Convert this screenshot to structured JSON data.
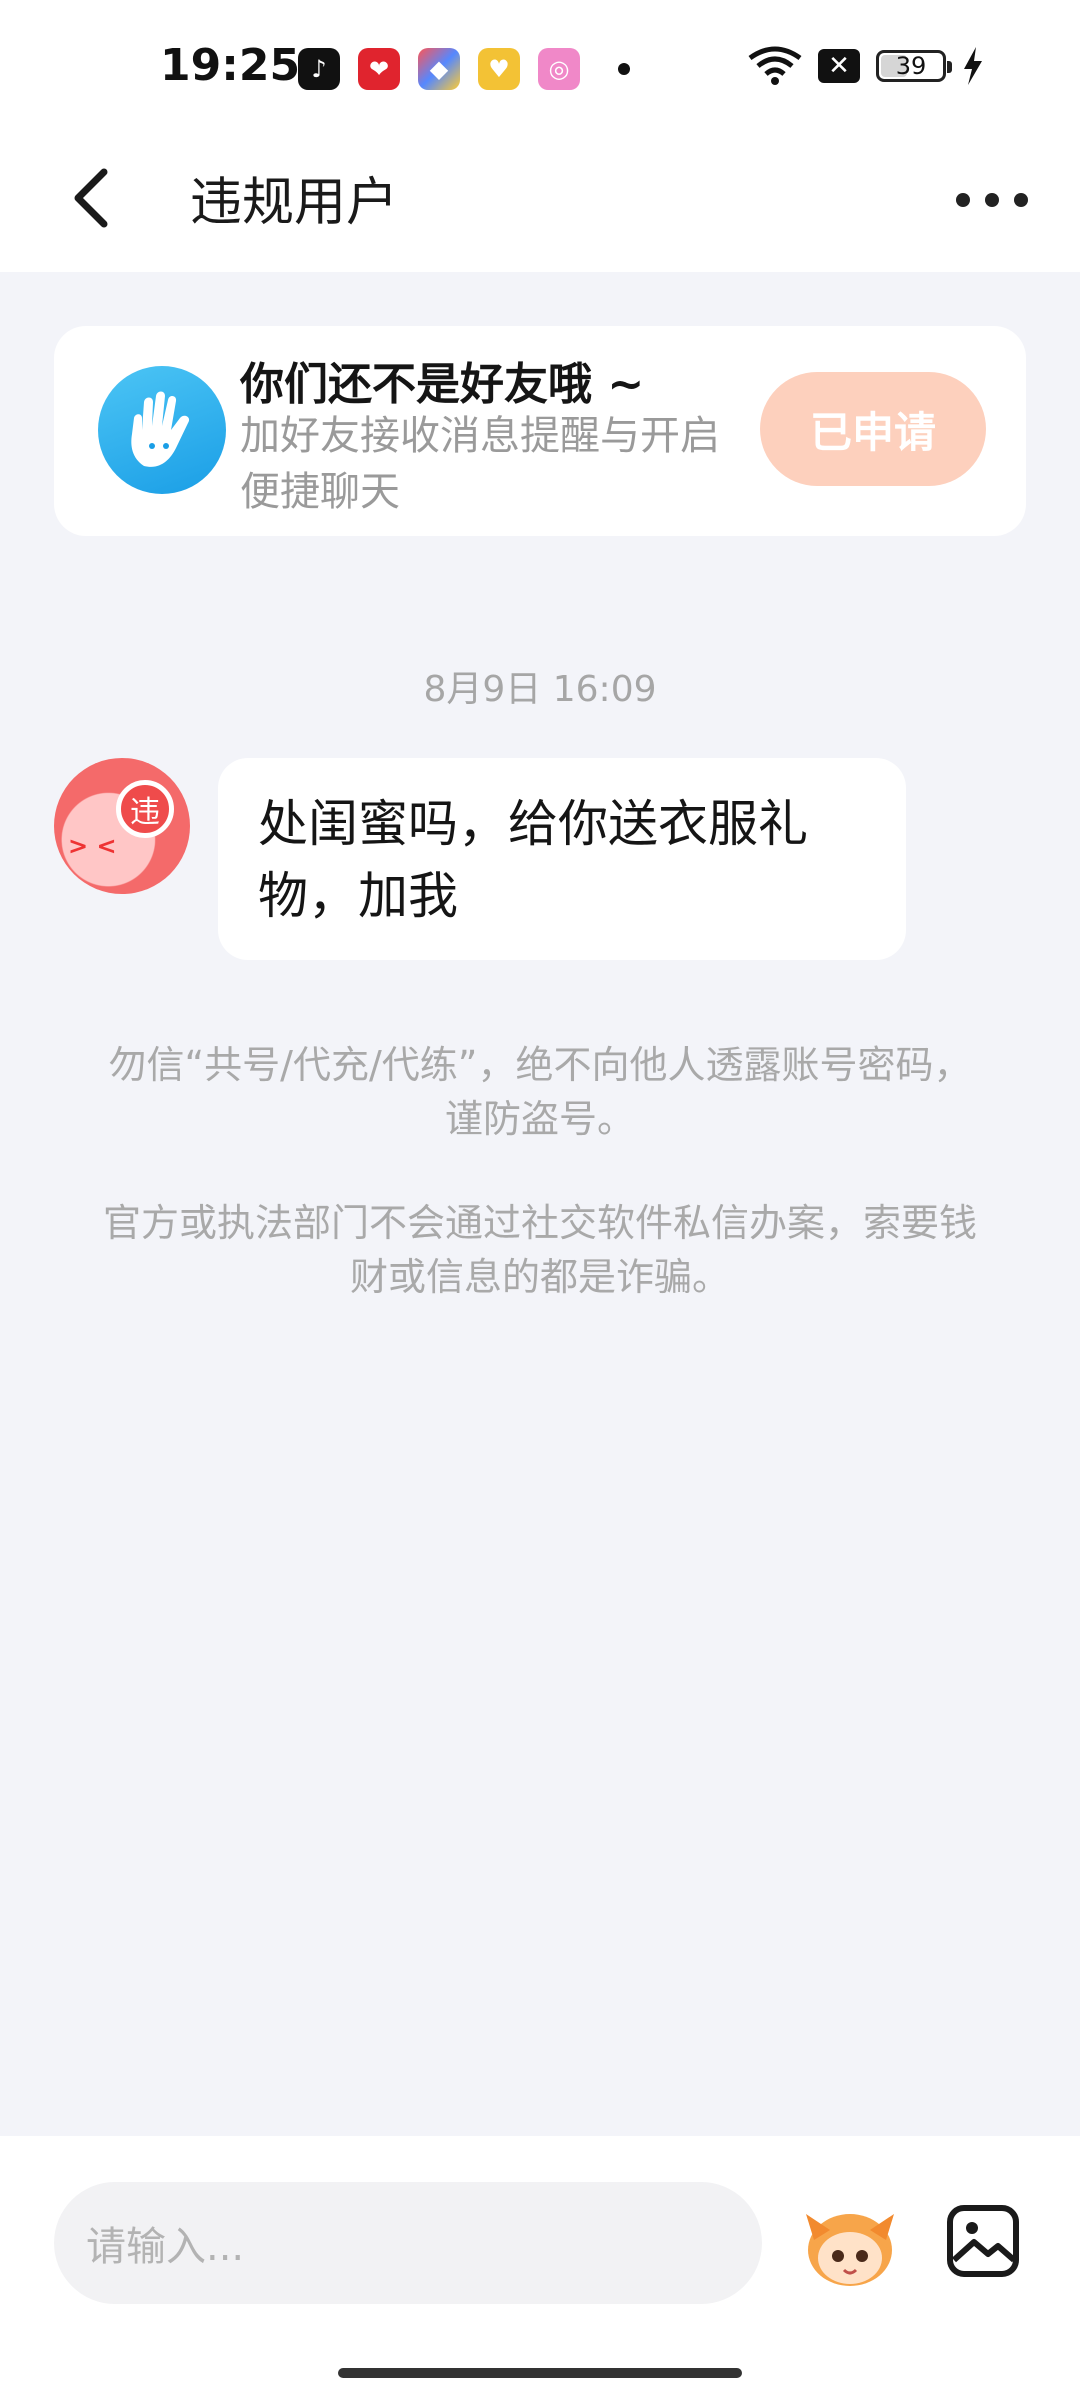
{
  "status_bar": {
    "time": "19:25",
    "apps": [
      {
        "icon": "tiktok-icon",
        "color": "#111111"
      },
      {
        "icon": "heart-app-icon",
        "color": "#e0242e"
      },
      {
        "icon": "multicolor-app-icon",
        "color": "#7a6cf2"
      },
      {
        "icon": "yellow-heart-app-icon",
        "color": "#f3c235"
      },
      {
        "icon": "pink-camera-app-icon",
        "color": "#f088c8"
      }
    ],
    "battery_level": "39"
  },
  "header": {
    "title": "违规用户"
  },
  "friend_card": {
    "title": "你们还不是好友哦 ~",
    "subtitle": "加好友接收消息提醒与开启便捷聊天",
    "button_label": "已申请"
  },
  "chat": {
    "timestamp": "8月9日 16:09",
    "avatar_badge": "违",
    "message": "处闺蜜吗，给你送衣服礼物，加我",
    "notice_1": "勿信“共号/代充/代练”，绝不向他人透露账号密码，谨防盗号。",
    "notice_2": "官方或执法部门不会通过社交软件私信办案，索要钱财或信息的都是诈骗。"
  },
  "input_bar": {
    "placeholder": "请输入..."
  }
}
